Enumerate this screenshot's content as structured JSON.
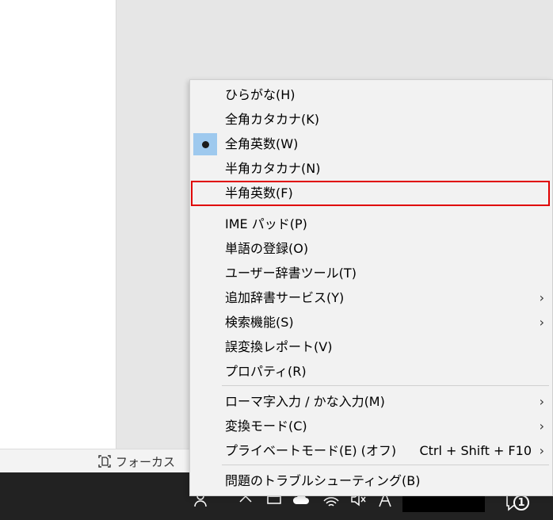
{
  "statusbar": {
    "focus_label": "フォーカス"
  },
  "menu": {
    "items": [
      {
        "label": "ひらがな(H)"
      },
      {
        "label": "全角カタカナ(K)"
      },
      {
        "label": "全角英数(W)",
        "checked": true
      },
      {
        "label": "半角カタカナ(N)"
      },
      {
        "label": "半角英数(F)",
        "highlighted": true
      },
      {
        "label": "IME パッド(P)"
      },
      {
        "label": "単語の登録(O)"
      },
      {
        "label": "ユーザー辞書ツール(T)"
      },
      {
        "label": "追加辞書サービス(Y)",
        "submenu": true
      },
      {
        "label": "検索機能(S)",
        "submenu": true
      },
      {
        "label": "誤変換レポート(V)"
      },
      {
        "label": "プロパティ(R)"
      },
      {
        "label": "ローマ字入力 / かな入力(M)",
        "submenu": true
      },
      {
        "label": "変換モード(C)",
        "submenu": true
      },
      {
        "label": "プライベートモード(E) (オフ)",
        "shortcut": "Ctrl + Shift + F10",
        "submenu": true
      },
      {
        "label": "問題のトラブルシューティング(B)"
      }
    ],
    "arrow_glyph": "›",
    "highlight_color": "#e00000",
    "check_bg_color": "#9ec9ee"
  },
  "taskbar": {
    "notification_count": "1"
  }
}
